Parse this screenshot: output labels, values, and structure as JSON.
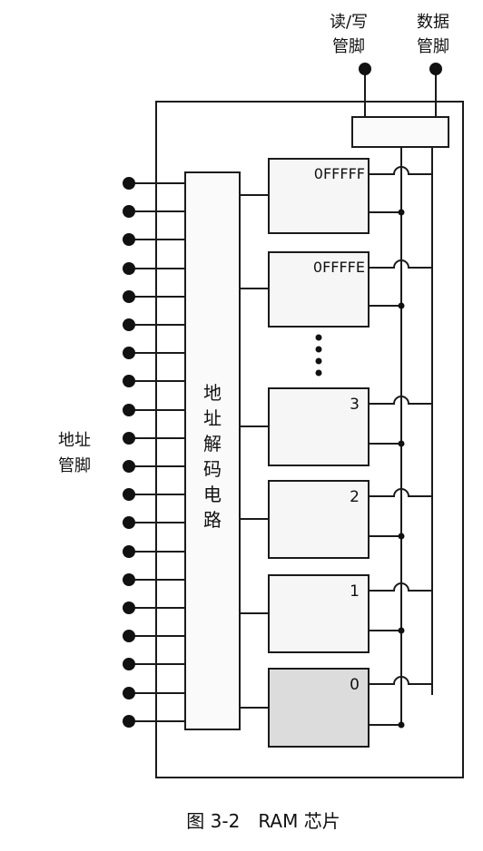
{
  "pins": {
    "rw_label": [
      "读/写",
      "管脚"
    ],
    "data_label": [
      "数据",
      "管脚"
    ],
    "address_label": [
      "地址",
      "管脚"
    ]
  },
  "decoder": {
    "label_chars": [
      "地",
      "址",
      "解",
      "码",
      "电",
      "路"
    ]
  },
  "memory_cells": [
    {
      "label": "0FFFFF",
      "shaded": false
    },
    {
      "label": "0FFFFE",
      "shaded": false
    },
    {
      "label": "3",
      "shaded": false
    },
    {
      "label": "2",
      "shaded": false
    },
    {
      "label": "1",
      "shaded": false
    },
    {
      "label": "0",
      "shaded": true
    }
  ],
  "caption": "图 3-2　RAM 芯片",
  "colors": {
    "line": "#1a1a1a",
    "cell_fill": "#f6f6f6",
    "cell_shaded": "#dcdcdc"
  }
}
